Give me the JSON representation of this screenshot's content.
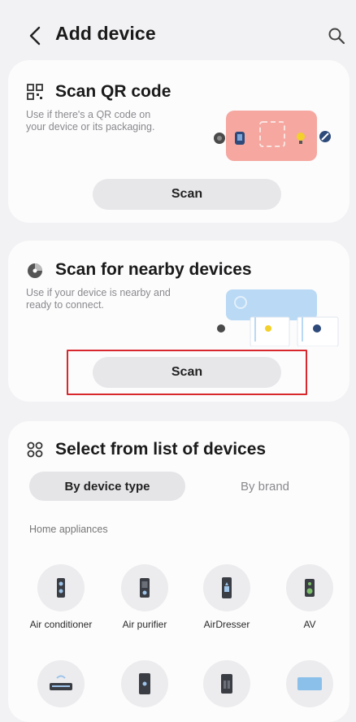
{
  "header": {
    "title": "Add device"
  },
  "qr": {
    "title": "Scan QR code",
    "description": "Use if there's a QR code on your device or its packaging.",
    "scan_label": "Scan"
  },
  "nearby": {
    "title": "Scan for nearby devices",
    "description": "Use if your device is nearby and ready to connect.",
    "scan_label": "Scan"
  },
  "list": {
    "title": "Select from list of devices",
    "tabs": [
      {
        "label": "By device type",
        "active": true
      },
      {
        "label": "By brand",
        "active": false
      }
    ],
    "section": "Home appliances",
    "devices": [
      {
        "label": "Air conditioner",
        "icon": "air-conditioner-icon"
      },
      {
        "label": "Air purifier",
        "icon": "air-purifier-icon"
      },
      {
        "label": "AirDresser",
        "icon": "airdresser-icon"
      },
      {
        "label": "AV",
        "icon": "av-speaker-icon"
      },
      {
        "label": "",
        "icon": "soundbar-icon"
      },
      {
        "label": "",
        "icon": "refrigerator-icon"
      },
      {
        "label": "",
        "icon": "washer-icon"
      },
      {
        "label": "",
        "icon": "tv-icon"
      }
    ]
  },
  "colors": {
    "highlight": "#d9272e",
    "qr_illustration": "#f5a7a0",
    "nearby_illustration": "#b9d9f5"
  }
}
